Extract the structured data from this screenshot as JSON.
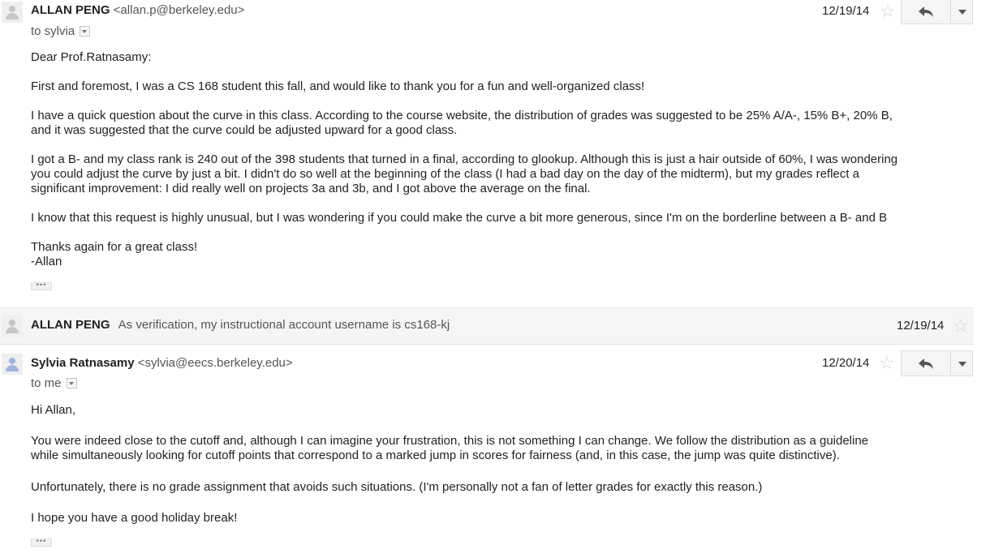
{
  "messages": [
    {
      "sender": "ALLAN PENG",
      "email": "<allan.p@berkeley.edu>",
      "to": "to sylvia",
      "date": "12/19/14",
      "paragraphs": [
        [
          "Dear Prof.Ratnasamy:"
        ],
        [
          "First and foremost, I was a CS 168 student this fall, and would like to thank you for a fun and well-organized class!"
        ],
        [
          "I have a quick question about the curve in this class. According to the course website, the distribution of grades was suggested to be 25% A/A-, 15% B+, 20% B,",
          "and it was suggested that the curve could be adjusted upward for a good class."
        ],
        [
          "I got a B- and my class rank is 240 out of the 398 students that turned in a final, according to glookup. Although this is just a hair outside of 60%, I was wondering",
          "you could adjust the curve by just a bit. I didn't do so well at the beginning of the class (I had a bad day on the day of the midterm), but my grades reflect a",
          "significant improvement: I did really well on projects 3a and 3b, and I got above the average on the final."
        ],
        [
          "I know that this request is highly unusual, but I was wondering if you could make the curve a bit more generous, since I'm on the borderline between a B- and B"
        ],
        [
          "Thanks again for a great class!",
          "-Allan"
        ]
      ]
    },
    {
      "sender": "ALLAN PENG",
      "snippet": "As verification, my instructional account username is cs168-kj",
      "date": "12/19/14"
    },
    {
      "sender": "Sylvia Ratnasamy",
      "email": "<sylvia@eecs.berkeley.edu>",
      "to": "to me",
      "date": "12/20/14",
      "paragraphs": [
        [
          "Hi Allan,"
        ],
        [
          "You were indeed close to the cutoff and, although I can imagine your frustration, this is not something I can change. We follow the distribution as a guideline",
          "while simultaneously looking for cutoff points that correspond to a marked jump in scores for fairness (and, in this case, the jump was quite distinctive)."
        ],
        [
          "Unfortunately, there is no grade assignment that avoids such situations. (I'm personally not a fan of letter grades for exactly this reason.)"
        ],
        [
          "I hope you have a good holiday break!"
        ]
      ]
    }
  ],
  "icons": {
    "avatar": "person-avatar-icon",
    "star": "star-icon",
    "reply": "reply-arrow-icon",
    "more": "chevron-down-icon",
    "details": "show-details-caret-icon",
    "trimmed": "show-trimmed-content-icon"
  },
  "ellipsis": "•••",
  "star_glyph": "☆",
  "colors": {
    "unread_avatar": "#9db4e3",
    "collapsed_row_bg": "#f5f5f5"
  }
}
